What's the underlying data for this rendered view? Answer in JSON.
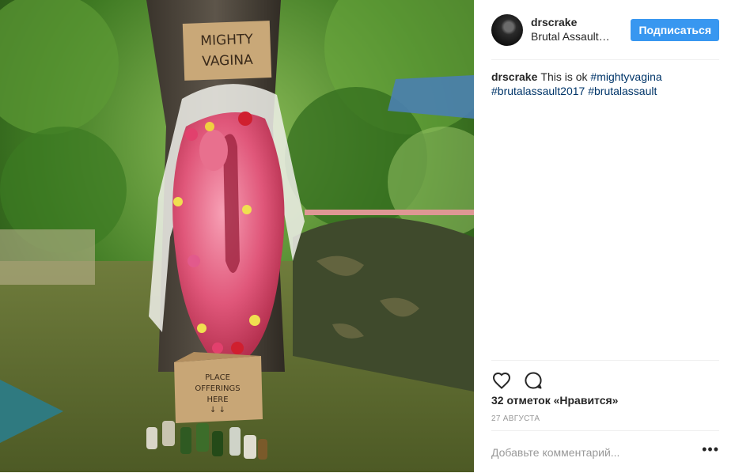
{
  "post": {
    "photo": {
      "sign_top_line1": "MIGHTY",
      "sign_top_line2": "VAGINA",
      "box_line1": "PLACE",
      "box_line2": "OFFERINGS",
      "box_line3": "HERE",
      "box_arrows": "↓ ↓"
    },
    "header": {
      "username": "drscrake",
      "location": "Brutal Assault…",
      "follow_label": "Подписаться"
    },
    "caption": {
      "username": "drscrake",
      "text": "This is ok",
      "hashtags": [
        "#mightyvagina",
        "#brutalassault2017",
        "#brutalassault"
      ]
    },
    "actions": {
      "like_icon": "heart-icon",
      "comment_icon": "comment-icon"
    },
    "likes_text": "32 отметок «Нравится»",
    "date_text": "27 августа",
    "comment": {
      "placeholder": "Добавьте комментарий...",
      "more_icon": "more-options-icon",
      "more_label": "•••"
    },
    "colors": {
      "follow_bg": "#3897f0",
      "hashtag": "#003569",
      "muted": "#999999"
    }
  }
}
